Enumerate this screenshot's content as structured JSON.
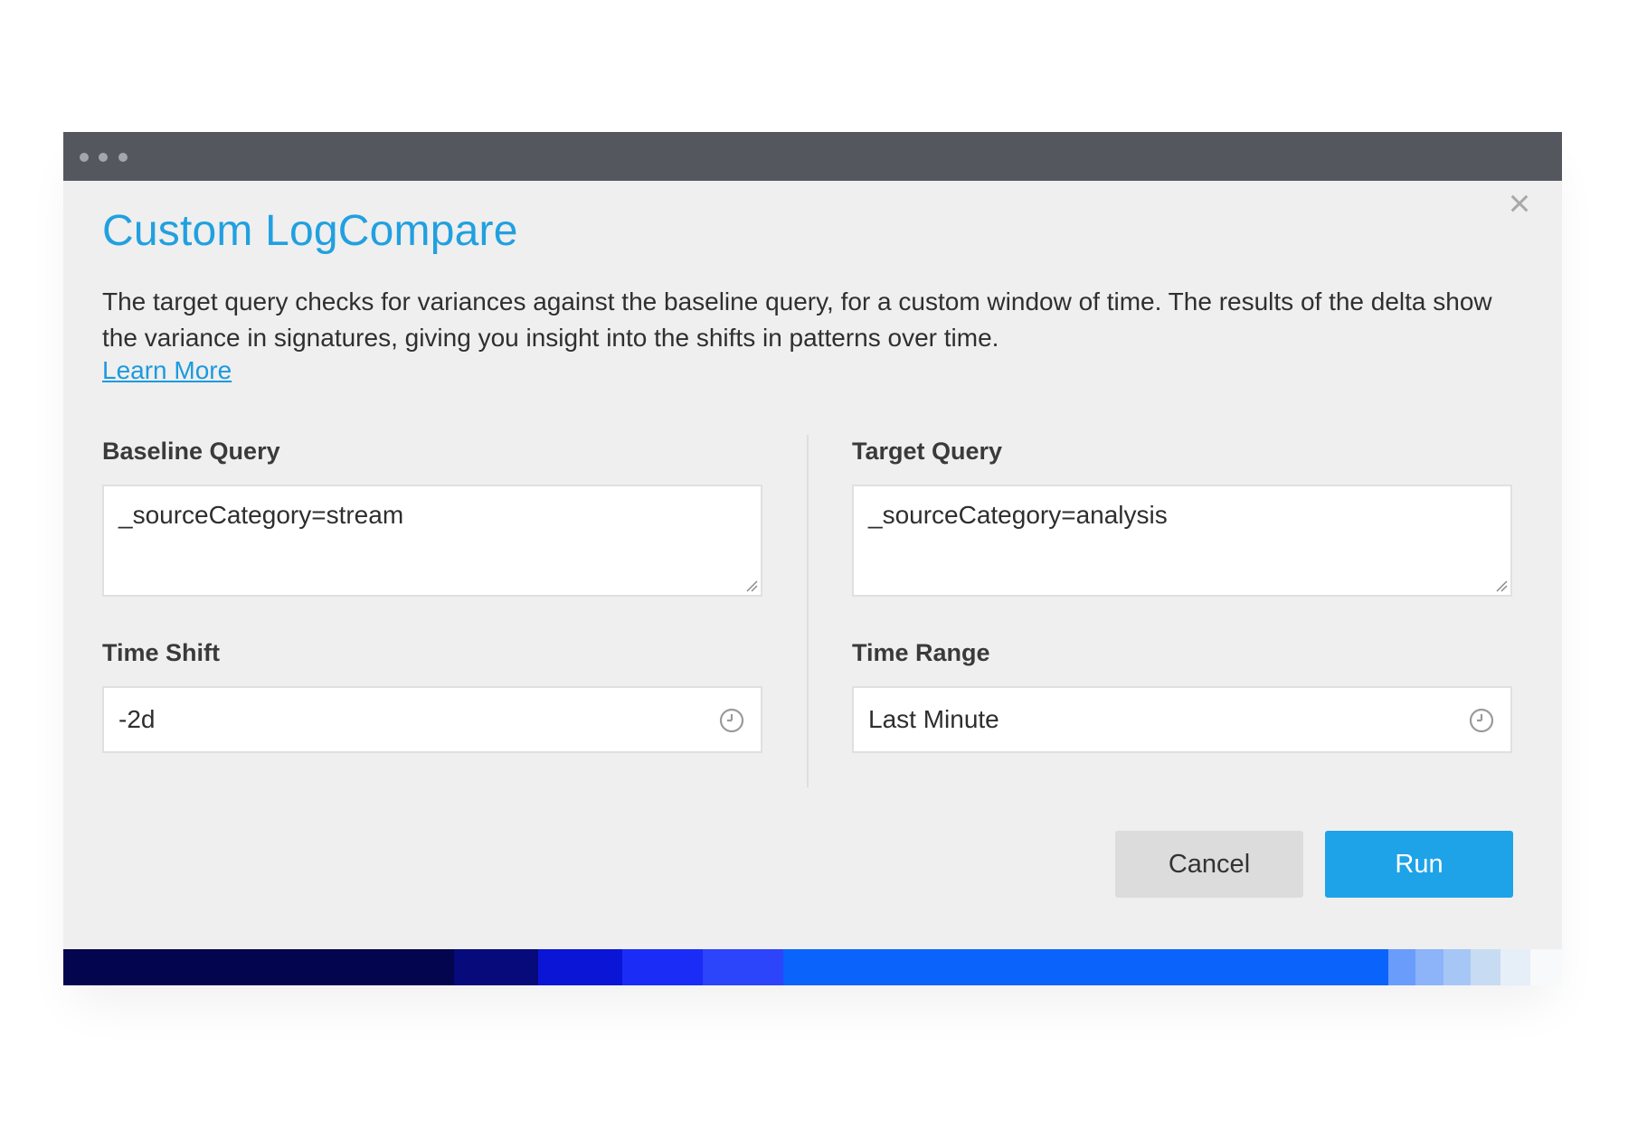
{
  "dialog": {
    "title": "Custom LogCompare",
    "description": "The target query checks for variances against the baseline query, for a custom window of time. The results of the delta show the variance in signatures, giving you insight into the shifts in patterns over time.",
    "learn_more": "Learn More",
    "close_icon": "close-icon"
  },
  "baseline": {
    "label": "Baseline Query",
    "value": "_sourceCategory=stream"
  },
  "target": {
    "label": "Target Query",
    "value": "_sourceCategory=analysis"
  },
  "time_shift": {
    "label": "Time Shift",
    "value": "-2d",
    "icon": "clock-icon"
  },
  "time_range": {
    "label": "Time Range",
    "value": "Last Minute",
    "icon": "clock-icon"
  },
  "buttons": {
    "cancel": "Cancel",
    "run": "Run"
  },
  "colors": {
    "accent": "#1ea3e8",
    "title": "#21a0e0",
    "titlebar": "#54575d",
    "gradient": [
      "#04054f",
      "#04054f",
      "#060a7a",
      "#0b15d6",
      "#1b2cf7",
      "#2c44fa",
      "#0a64fb",
      "#0a64fb",
      "#6a9cfb",
      "#8db3f9",
      "#a6c6f6",
      "#c7dcf2",
      "#e6eef8",
      "#f7f9fb"
    ]
  }
}
